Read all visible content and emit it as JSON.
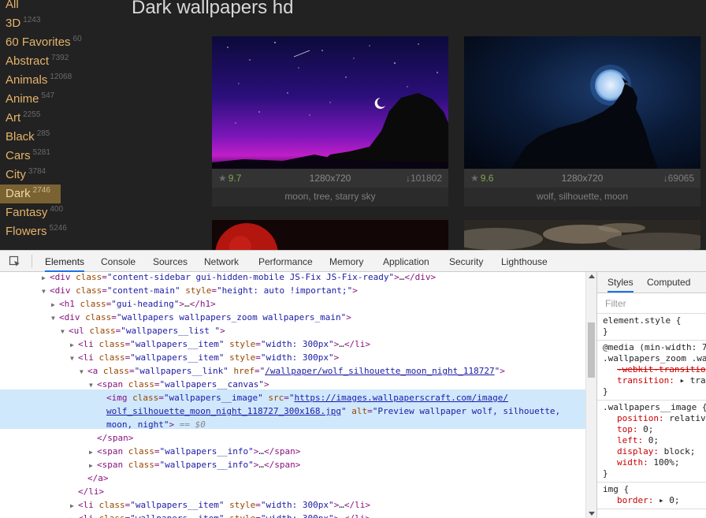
{
  "site": {
    "page_title": "Dark wallpapers hd",
    "categories": [
      {
        "name": "All",
        "count": ""
      },
      {
        "name": "3D",
        "count": "1243"
      },
      {
        "name": "60 Favorites",
        "count": "60"
      },
      {
        "name": "Abstract",
        "count": "7392"
      },
      {
        "name": "Animals",
        "count": "12068"
      },
      {
        "name": "Anime",
        "count": "547"
      },
      {
        "name": "Art",
        "count": "2255"
      },
      {
        "name": "Black",
        "count": "285"
      },
      {
        "name": "Cars",
        "count": "5281"
      },
      {
        "name": "City",
        "count": "3784"
      },
      {
        "name": "Dark",
        "count": "2746"
      },
      {
        "name": "Fantasy",
        "count": "400"
      },
      {
        "name": "Flowers",
        "count": "5246"
      }
    ],
    "active_category": "Dark",
    "wallpapers": [
      {
        "rating": "9.7",
        "resolution": "1280x720",
        "downloads": "101802",
        "tags": "moon, tree, starry sky"
      },
      {
        "rating": "9.6",
        "resolution": "1280x720",
        "downloads": "69065",
        "tags": "wolf, silhouette, moon"
      }
    ],
    "colors": {
      "accent": "#e6b36a",
      "active_bg": "#7a6233",
      "rating": "#7fa64e"
    }
  },
  "devtools": {
    "tabs": [
      "Elements",
      "Console",
      "Sources",
      "Network",
      "Performance",
      "Memory",
      "Application",
      "Security",
      "Lighthouse"
    ],
    "active_tab": "Elements",
    "dom": {
      "l1": {
        "tag": "div",
        "class": "content-sidebar gui-hidden-mobile JS-Fix JS-Fix-ready"
      },
      "l2": {
        "tag": "div",
        "class": "content-main",
        "style": "height: auto !important;"
      },
      "l3": {
        "tag": "h1",
        "class": "gui-heading"
      },
      "l4": {
        "tag": "div",
        "class": "wallpapers wallpapers_zoom wallpapers_main"
      },
      "l5": {
        "tag": "ul",
        "class": "wallpapers__list "
      },
      "l6": {
        "tag": "li",
        "class": "wallpapers__item",
        "style": "width: 300px"
      },
      "l7": {
        "tag": "li",
        "class": "wallpapers__item",
        "style": "width: 300px"
      },
      "l8": {
        "tag": "a",
        "class": "wallpapers__link",
        "href": "/wallpaper/wolf_silhouette_moon_night_118727"
      },
      "l9": {
        "tag": "span",
        "class": "wallpapers__canvas"
      },
      "l10": {
        "tag": "img",
        "class": "wallpapers__image",
        "src_part1": "https://images.wallpaperscraft.com/image/",
        "src_part2": "wolf_silhouette_moon_night_118727_300x168.jpg",
        "alt_part1": "Preview wallpaper wolf, silhouette,",
        "alt_part2": "moon, night",
        "selected_marker": "== $0"
      },
      "l11": {
        "close": "/span"
      },
      "l12": {
        "tag": "span",
        "class": "wallpapers__info"
      },
      "l13": {
        "tag": "span",
        "class": "wallpapers__info"
      },
      "l14": {
        "close": "/a"
      },
      "l15": {
        "close": "/li"
      },
      "l16": {
        "tag": "li",
        "class": "wallpapers__item",
        "style": "width: 300px"
      },
      "l17": {
        "tag": "li",
        "class": "wallpapers__item",
        "style": "width: 300px"
      }
    },
    "styles": {
      "tabs": [
        "Styles",
        "Computed"
      ],
      "filter_placeholder": "Filter",
      "rule1": {
        "selector": "element.style {",
        "close": "}"
      },
      "rule2": {
        "media": "@media (min-width: 7",
        "selector": ".wallpapers_zoom .wa",
        "p1": "-webkit-transitio",
        "p2_name": "transition:",
        "p2_val": "▸ tran",
        "close": "}"
      },
      "rule3": {
        "selector": ".wallpapers__image {",
        "props": [
          {
            "name": "position:",
            "value": "relativ"
          },
          {
            "name": "top:",
            "value": "0;"
          },
          {
            "name": "left:",
            "value": "0;"
          },
          {
            "name": "display:",
            "value": "block;"
          },
          {
            "name": "width:",
            "value": "100%;"
          }
        ],
        "close": "}"
      },
      "rule4": {
        "selector": "img {",
        "p_name": "border:",
        "p_val": "▸ 0;"
      }
    }
  }
}
